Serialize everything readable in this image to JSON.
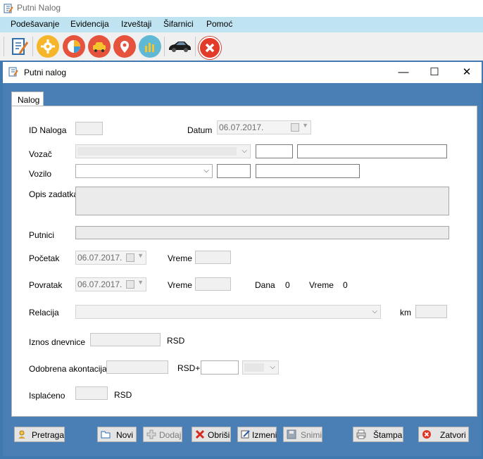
{
  "app": {
    "title": "Putni Nalog"
  },
  "menu": {
    "items": [
      "Podešavanje",
      "Evidencija",
      "Izveštaji",
      "Šifarnici",
      "Pomoć"
    ]
  },
  "toolbar": {
    "icons": [
      "nalog-icon",
      "settings-icon",
      "chart-icon",
      "car-icon",
      "location-icon",
      "report-icon",
      "vehicle-icon",
      "exit-icon"
    ]
  },
  "child": {
    "title": "Putni nalog",
    "minimize": "—",
    "maximize": "☐",
    "close": "✕"
  },
  "tab": {
    "label": "Nalog"
  },
  "form": {
    "id_label": "ID Naloga",
    "datum_label": "Datum",
    "datum_value": "06.07.2017.",
    "vozac_label": "Vozač",
    "vozilo_label": "Vozilo",
    "opis_label": "Opis zadatka",
    "putnici_label": "Putnici",
    "pocetak_label": "Početak",
    "pocetak_value": "06.07.2017.",
    "vreme_label": "Vreme",
    "povratak_label": "Povratak",
    "povratak_value": "06.07.2017.",
    "dana_label": "Dana",
    "dana_value": "0",
    "vreme2_label": "Vreme",
    "vreme2_value": "0",
    "relacija_label": "Relacija",
    "km_label": "km",
    "iznos_label": "Iznos dnevnice",
    "rsd1": "RSD",
    "akontacija_label": "Odobrena akontacija",
    "rsd_plus": "RSD+",
    "isplaceno_label": "Isplaćeno",
    "rsd2": "RSD"
  },
  "buttons": {
    "pretraga": "Pretraga",
    "novi": "Novi",
    "dodaj": "Dodaj",
    "obrisi": "Obriši",
    "izmeni": "Izmeni",
    "snimi": "Snimi",
    "stampa": "Štampa",
    "zatvori": "Zatvori"
  }
}
